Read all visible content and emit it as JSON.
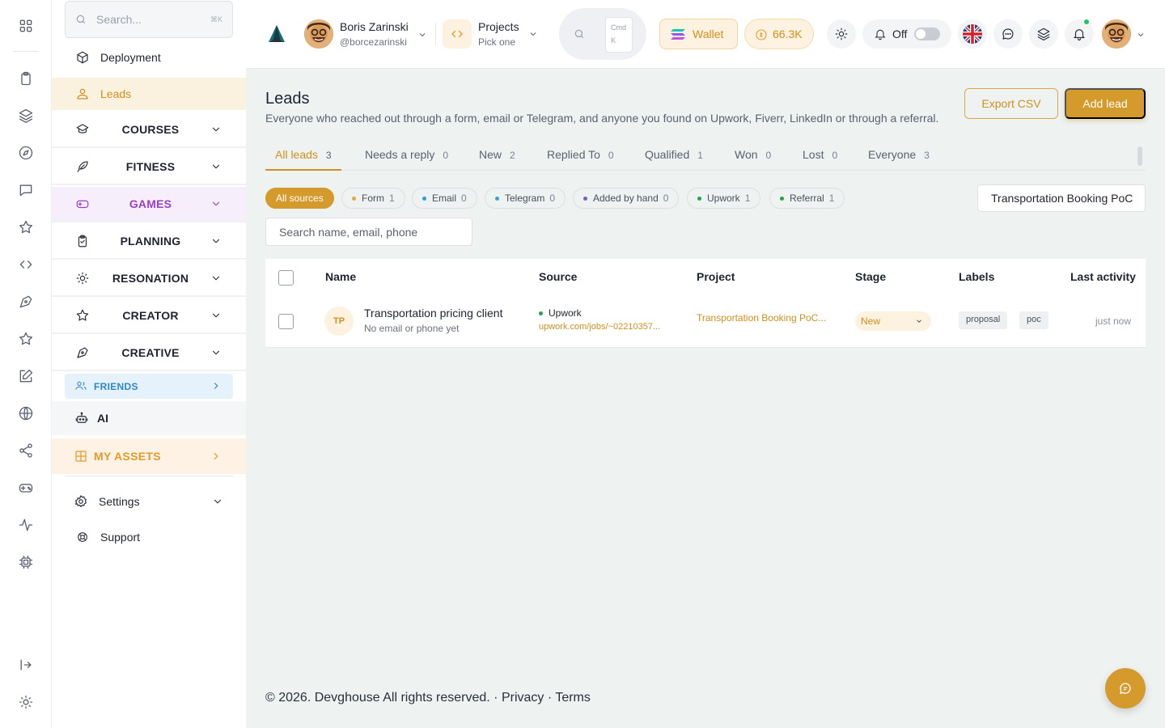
{
  "user": {
    "name": "Boris Zarinski",
    "handle": "@borcezarinski"
  },
  "projects_menu": {
    "title": "Projects",
    "subtitle": "Pick one"
  },
  "command": {
    "kbd_line1": "Cmd",
    "kbd_line2": "K"
  },
  "wallet": {
    "label": "Wallet"
  },
  "coins": {
    "value": "66.3K"
  },
  "notifications_toggle": {
    "label": "Off",
    "enabled": false
  },
  "sidebar": {
    "search_placeholder": "Search...",
    "search_kbd": "⌘K",
    "items": [
      {
        "label": "Deployment",
        "icon": "box-icon"
      },
      {
        "label": "Leads",
        "icon": "users-icon",
        "active": true
      }
    ],
    "groups": [
      {
        "label": "COURSES",
        "icon": "courses-icon"
      },
      {
        "label": "FITNESS",
        "icon": "feather-icon"
      },
      {
        "label": "GAMES",
        "icon": "gamepad-icon"
      },
      {
        "label": "PLANNING",
        "icon": "clipboard-check-icon"
      },
      {
        "label": "RESONATION",
        "icon": "sun-icon"
      },
      {
        "label": "CREATOR",
        "icon": "star-icon"
      },
      {
        "label": "CREATIVE",
        "icon": "pen-tool-icon"
      }
    ],
    "friends": "FRIENDS",
    "ai": "AI",
    "my_assets": "MY ASSETS",
    "settings": "Settings",
    "support": "Support"
  },
  "page": {
    "title": "Leads",
    "description": "Everyone who reached out through a form, email or Telegram, and anyone you found on Upwork, Fiverr, LinkedIn or through a referral.",
    "export_label": "Export CSV",
    "add_label": "Add lead"
  },
  "tabs": [
    {
      "label": "All leads",
      "count": "3",
      "active": true
    },
    {
      "label": "Needs a reply",
      "count": "0"
    },
    {
      "label": "New",
      "count": "2"
    },
    {
      "label": "Replied To",
      "count": "0"
    },
    {
      "label": "Qualified",
      "count": "1"
    },
    {
      "label": "Won",
      "count": "0"
    },
    {
      "label": "Lost",
      "count": "0"
    },
    {
      "label": "Everyone",
      "count": "3"
    }
  ],
  "sources": [
    {
      "label": "All sources",
      "count": "",
      "active": true
    },
    {
      "label": "Form",
      "count": "1",
      "color": "#e5a93a"
    },
    {
      "label": "Email",
      "count": "0",
      "color": "#2f9be0"
    },
    {
      "label": "Telegram",
      "count": "0",
      "color": "#2fa6d8"
    },
    {
      "label": "Added by hand",
      "count": "0",
      "color": "#7a5bc9"
    },
    {
      "label": "Upwork",
      "count": "1",
      "color": "#22a447"
    },
    {
      "label": "Referral",
      "count": "1",
      "color": "#22a447"
    }
  ],
  "project_filter": "Transportation Booking PoC",
  "lead_search_placeholder": "Search name, email, phone",
  "table": {
    "headers": [
      "Name",
      "Source",
      "Project",
      "Stage",
      "Labels",
      "Last activity"
    ],
    "rows": [
      {
        "initials": "TP",
        "name": "Transportation pricing client",
        "contact": "No email or phone yet",
        "source": "Upwork",
        "source_link": "upwork.com/jobs/~02210357...",
        "project": "Transportation Booking PoC...",
        "stage": "New",
        "labels": [
          "proposal",
          "poc"
        ],
        "last_activity": "just now"
      }
    ]
  },
  "footer": "© 2026. Devghouse All rights reserved. · Privacy · Terms",
  "colors": {
    "accent": "#d49a2c",
    "games": "#9a3fc7",
    "friends": "#2f86c9"
  }
}
